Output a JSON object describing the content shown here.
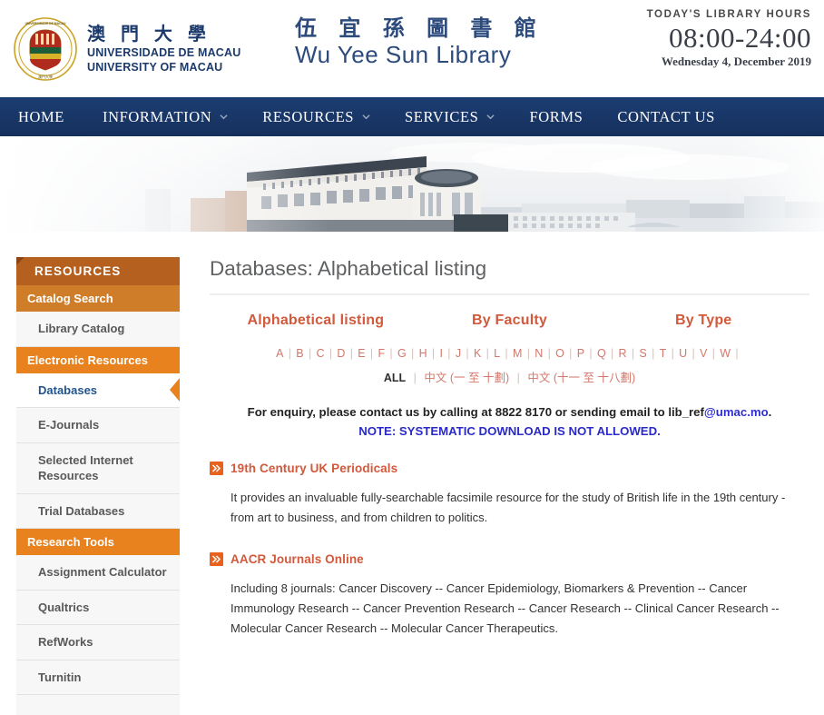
{
  "header": {
    "university_cn": "澳 門 大 學",
    "university_pt": "UNIVERSIDADE DE MACAU",
    "university_en": "UNIVERSITY OF MACAU",
    "library_cn": "伍 宜 孫 圖 書 館",
    "library_en": "Wu Yee Sun Library",
    "hours_label": "TODAY'S LIBRARY HOURS",
    "hours_time": "08:00-24:00",
    "hours_date": "Wednesday 4, December 2019",
    "crest_alt": "university-crest"
  },
  "nav": {
    "items": [
      {
        "label": "HOME",
        "has_caret": false
      },
      {
        "label": "INFORMATION",
        "has_caret": true
      },
      {
        "label": "RESOURCES",
        "has_caret": true
      },
      {
        "label": "SERVICES",
        "has_caret": true
      },
      {
        "label": "FORMS",
        "has_caret": false
      },
      {
        "label": "CONTACT US",
        "has_caret": false
      }
    ]
  },
  "sidebar": {
    "title": "RESOURCES",
    "groups": [
      {
        "label": "Catalog Search",
        "type": "group"
      },
      {
        "label": "Library Catalog",
        "type": "link"
      },
      {
        "label": "Electronic Resources",
        "type": "group"
      },
      {
        "label": "Databases",
        "type": "link",
        "active": true
      },
      {
        "label": "E-Journals",
        "type": "link"
      },
      {
        "label": "Selected Internet Resources",
        "type": "link"
      },
      {
        "label": "Trial Databases",
        "type": "link"
      },
      {
        "label": "Research Tools",
        "type": "group"
      },
      {
        "label": "Assignment Calculator",
        "type": "link"
      },
      {
        "label": "Qualtrics",
        "type": "link"
      },
      {
        "label": "RefWorks",
        "type": "link"
      },
      {
        "label": "Turnitin",
        "type": "link"
      }
    ]
  },
  "main": {
    "page_title": "Databases: Alphabetical listing",
    "tabs": [
      {
        "label": "Alphabetical listing"
      },
      {
        "label": "By Faculty"
      },
      {
        "label": "By Type"
      }
    ],
    "letters": [
      "A",
      "B",
      "C",
      "D",
      "E",
      "F",
      "G",
      "H",
      "I",
      "J",
      "K",
      "L",
      "M",
      "N",
      "O",
      "P",
      "Q",
      "R",
      "S",
      "T",
      "U",
      "V",
      "W"
    ],
    "all_label": "ALL",
    "chinese_links": [
      "中文 (一 至 十劃)",
      "中文 (十一 至 十八劃)"
    ],
    "enquiry_prefix": "For enquiry, please contact us by calling at 8822 8170 or sending email to lib_ref",
    "enquiry_email_domain": "@umac.mo",
    "enquiry_suffix": ".",
    "note": "NOTE: SYSTEMATIC DOWNLOAD IS NOT ALLOWED.",
    "databases": [
      {
        "name": "19th Century UK Periodicals",
        "description": "It provides an invaluable fully-searchable facsimile resource for the study of British life in the 19th century - from art to business, and from children to politics."
      },
      {
        "name": "AACR Journals Online",
        "description": "Including 8 journals: Cancer Discovery -- Cancer Epidemiology, Biomarkers & Prevention -- Cancer Immunology Research -- Cancer Prevention Research -- Cancer Research -- Clinical Cancer Research -- Molecular Cancer Research -- Molecular Cancer Therapeutics."
      }
    ]
  },
  "colors": {
    "nav_blue": "#1c3d72",
    "sidebar_title": "#b5601e",
    "sidebar_group": "#e8821e",
    "accent_orange": "#d2593b",
    "bullet_orange": "#e8621e",
    "link_blue": "#21548c",
    "note_blue": "#2a2ac8"
  }
}
